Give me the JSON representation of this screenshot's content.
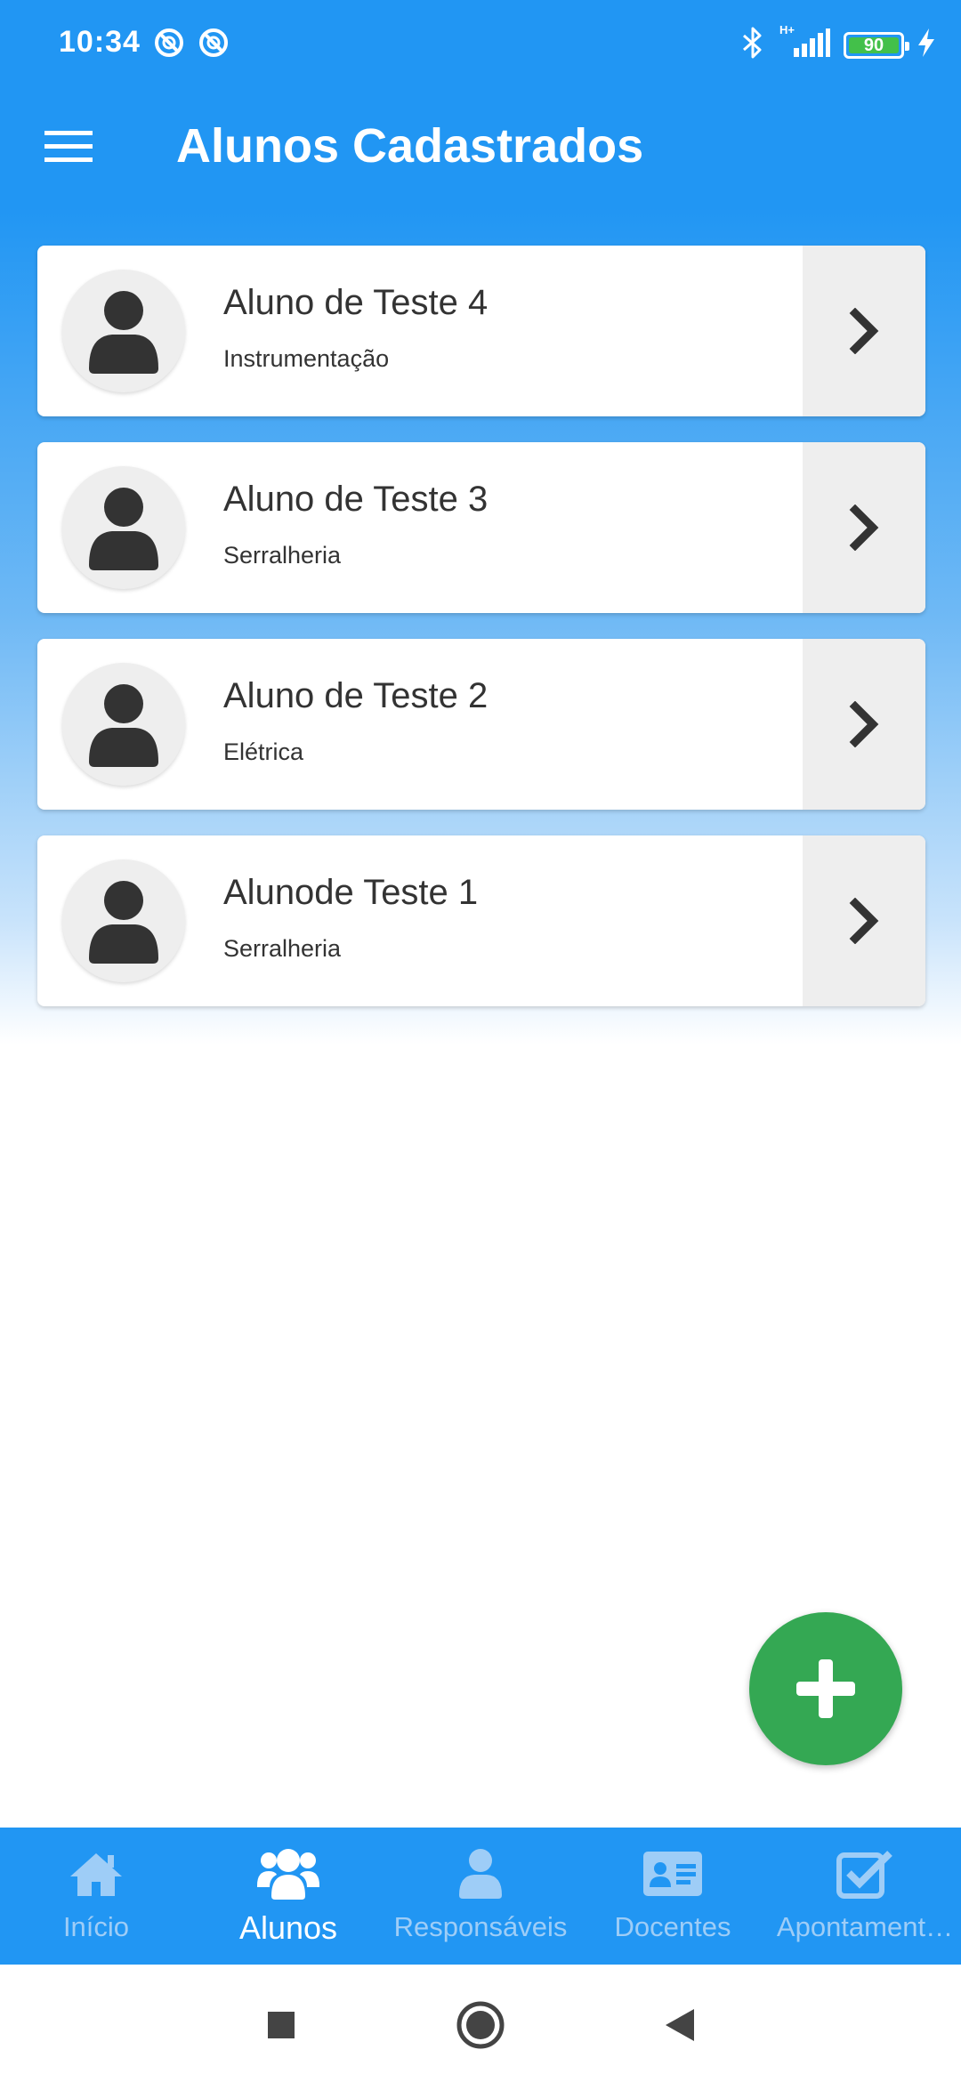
{
  "status_bar": {
    "time": "10:34",
    "battery": "90",
    "network": "H+",
    "icons_left": [
      "sync-off-icon",
      "sync-off-icon"
    ],
    "icons_right": [
      "bluetooth-icon",
      "signal-icon",
      "battery-icon",
      "charging-icon"
    ]
  },
  "app_bar": {
    "title": "Alunos Cadastrados",
    "menu_icon": "hamburger-menu-icon"
  },
  "students": [
    {
      "name": "Aluno de Teste 4",
      "course": "Instrumentação"
    },
    {
      "name": "Aluno de Teste 3",
      "course": "Serralheria"
    },
    {
      "name": "Aluno de Teste 2",
      "course": "Elétrica"
    },
    {
      "name": "Alunode Teste 1",
      "course": "Serralheria"
    }
  ],
  "fab": {
    "icon": "plus-icon"
  },
  "bottom_nav": {
    "items": [
      {
        "label": "Início",
        "icon": "home-icon"
      },
      {
        "label": "Alunos",
        "icon": "users-icon",
        "active": true
      },
      {
        "label": "Responsáveis",
        "icon": "user-icon"
      },
      {
        "label": "Docentes",
        "icon": "id-card-icon"
      },
      {
        "label": "Apontament…",
        "icon": "checkbox-icon"
      }
    ]
  },
  "colors": {
    "primary": "#2196f3",
    "fab": "#34a853",
    "nav_inactive": "#9ecdf7",
    "nav_active": "#ffffff",
    "text": "#333333"
  }
}
